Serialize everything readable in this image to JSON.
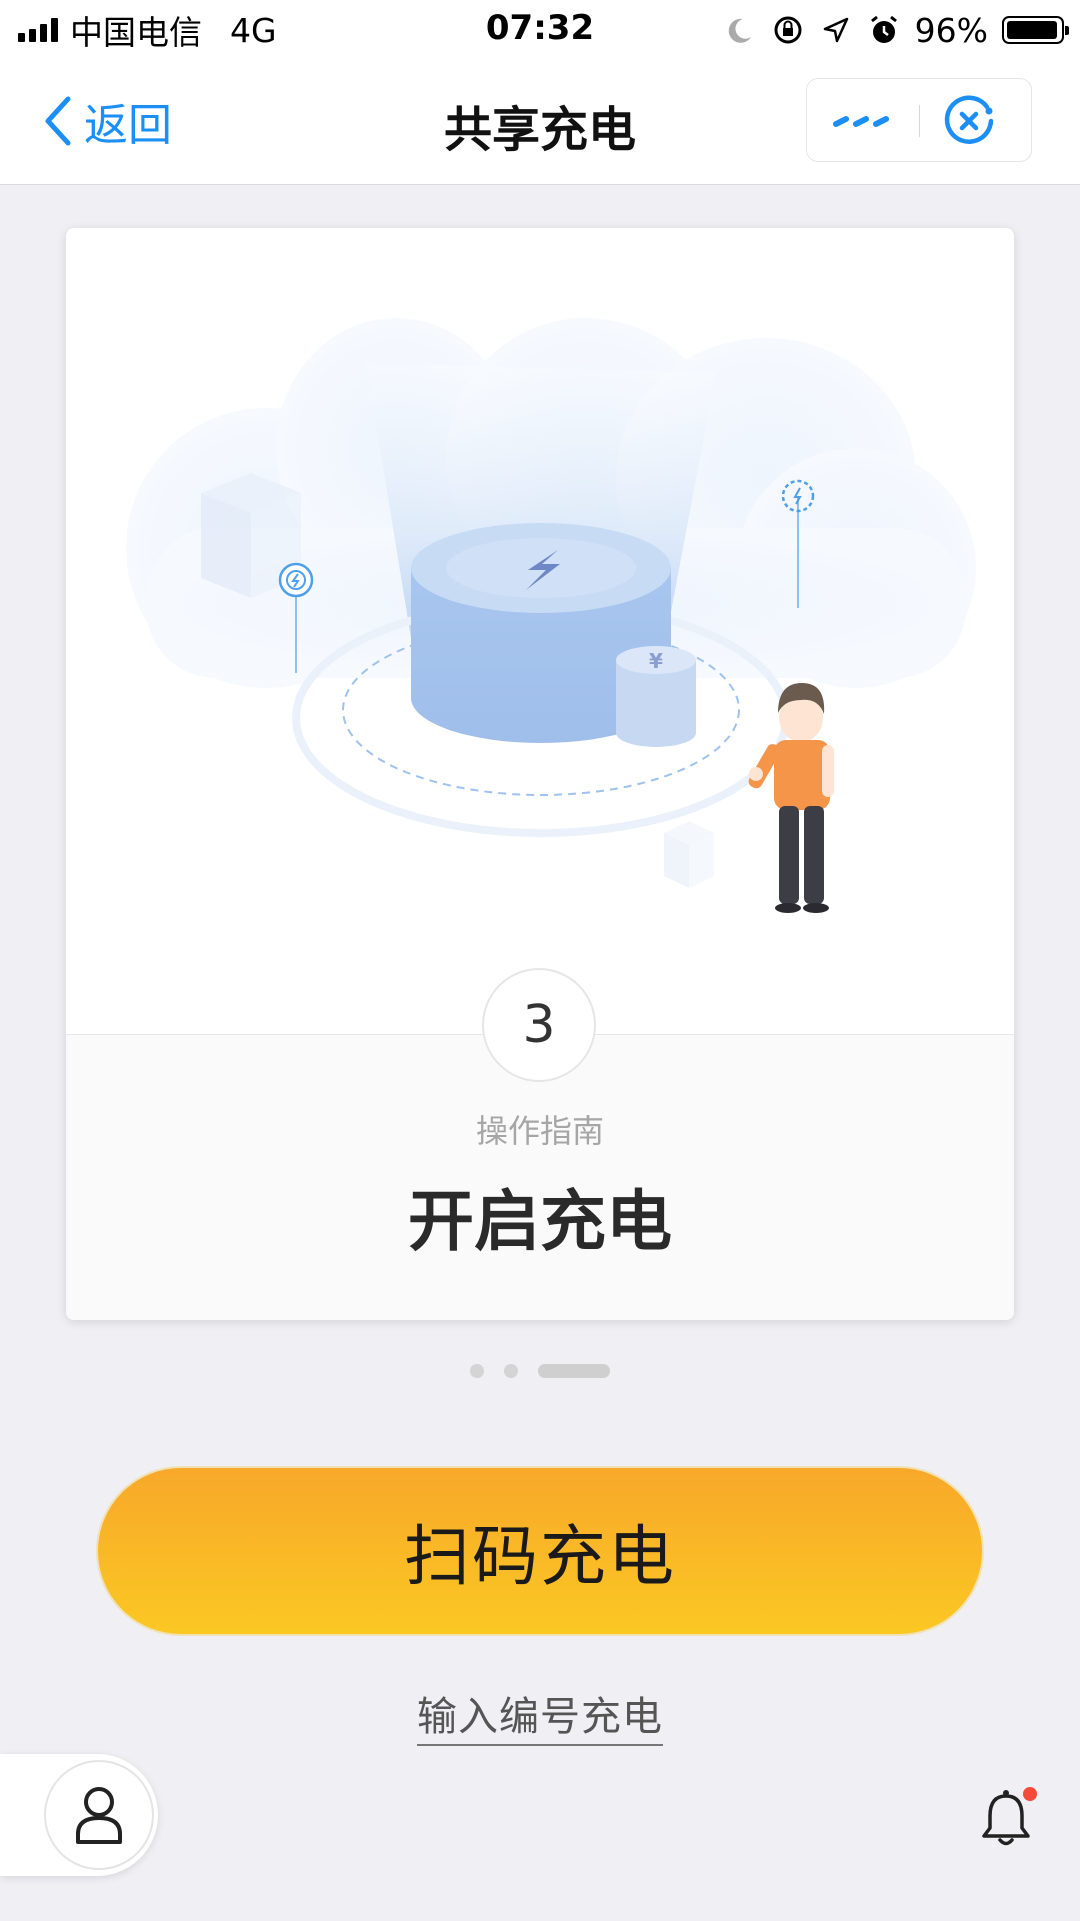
{
  "status_bar": {
    "carrier": "中国电信",
    "network": "4G",
    "time": "07:32",
    "battery_percent": "96%",
    "battery_level": 0.96,
    "icons": [
      "signal-icon",
      "moon-icon",
      "rotation-lock-icon",
      "location-icon",
      "alarm-icon",
      "battery-icon"
    ]
  },
  "nav": {
    "back_label": "返回",
    "title": "共享充电",
    "more_icon": "more-icon",
    "close_icon": "close-mini-program-icon",
    "accent_color": "#1b8ff5"
  },
  "card": {
    "step_number": "3",
    "guide_label": "操作指南",
    "step_title": "开启充电",
    "illustration_coin_symbol": "¥"
  },
  "pagination": {
    "total": 3,
    "active_index": 2
  },
  "actions": {
    "scan_label": "扫码充电",
    "input_code_label": "输入编号充电",
    "scan_gradient": [
      "#f8a82a",
      "#fbc823"
    ]
  },
  "bottom": {
    "profile_icon": "user-icon",
    "bell_icon": "bell-icon",
    "notification_dot_color": "#f5493a"
  }
}
